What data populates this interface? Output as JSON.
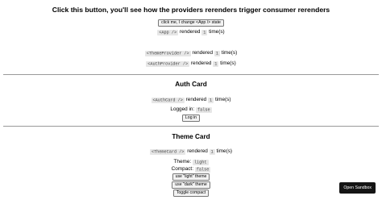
{
  "header": {
    "title": "Click this button, you'll see how the providers rerenders trigger consumer rerenders",
    "change_button": "click me, I change <App /> state"
  },
  "app": {
    "component": "<App />",
    "rendered_label": "rendered",
    "count": "1",
    "times_label": "time(s)"
  },
  "providers": {
    "theme_provider": {
      "component": "<ThemeProvider />",
      "rendered_label": "rendered",
      "count": "1",
      "times_label": "time(s)"
    },
    "auth_provider": {
      "component": "<AuthProvider />",
      "rendered_label": "rendered",
      "count": "1",
      "times_label": "time(s)"
    }
  },
  "auth_card": {
    "title": "Auth Card",
    "component": "<AuthCard />",
    "rendered_label": "rendered",
    "count": "1",
    "times_label": "time(s)",
    "logged_in_label": "Logged in:",
    "logged_in_value": "false",
    "login_button": "Log in"
  },
  "theme_card": {
    "title": "Theme Card",
    "component": "<ThemeCard />",
    "rendered_label": "rendered",
    "count": "1",
    "times_label": "time(s)",
    "theme_label": "Theme:",
    "theme_value": "light",
    "compact_label": "Compact:",
    "compact_value": "false",
    "light_button": "use \"light\" theme",
    "dark_button": "use \"dark\" theme",
    "toggle_button": "Toggle compact"
  },
  "sandbox": {
    "open_button": "Open Sandbox"
  }
}
